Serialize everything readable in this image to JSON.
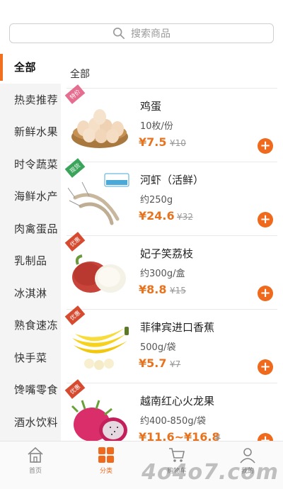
{
  "search": {
    "placeholder": "搜索商品"
  },
  "sidebar": {
    "items": [
      {
        "label": "全部"
      },
      {
        "label": "热卖推荐"
      },
      {
        "label": "新鲜水果"
      },
      {
        "label": "时令蔬菜"
      },
      {
        "label": "海鲜水产"
      },
      {
        "label": "肉禽蛋品"
      },
      {
        "label": "乳制品"
      },
      {
        "label": "冰淇淋"
      },
      {
        "label": "熟食速冻"
      },
      {
        "label": "快手菜"
      },
      {
        "label": "馋嘴零食"
      },
      {
        "label": "酒水饮料"
      }
    ]
  },
  "main": {
    "section_title": "全部",
    "products": [
      {
        "name": "鸡蛋",
        "spec": "10枚/份",
        "price": "¥7.5",
        "old_price": "¥10",
        "tag": "特价",
        "tag_color": "#e56d8f"
      },
      {
        "name": "河虾（活鲜）",
        "spec": "约250g",
        "price": "¥24.6",
        "old_price": "¥32",
        "tag": "现货",
        "tag_color": "#3aa45a"
      },
      {
        "name": "妃子笑荔枝",
        "spec": "约300g/盒",
        "price": "¥8.8",
        "old_price": "¥15",
        "tag": "优惠",
        "tag_color": "#d64a30"
      },
      {
        "name": "菲律宾进口香蕉",
        "spec": "500g/袋",
        "price": "¥5.7",
        "old_price": "¥7",
        "tag": "优惠",
        "tag_color": "#d64a30"
      },
      {
        "name": "越南红心火龙果",
        "spec": "约400-850g/袋",
        "price": "¥11.6~¥16.8",
        "old_price": "¥",
        "tag": "优惠",
        "tag_color": "#d64a30"
      }
    ]
  },
  "bottom_nav": {
    "items": [
      {
        "label": "首页",
        "icon": "home-icon"
      },
      {
        "label": "分类",
        "icon": "category-icon"
      },
      {
        "label": "购物车",
        "icon": "cart-icon"
      },
      {
        "label": "我的",
        "icon": "user-icon"
      }
    ]
  },
  "watermark": "4o4o7.com",
  "colors": {
    "accent": "#ef6a1d",
    "sidebar_bg": "#f4f4f4"
  }
}
